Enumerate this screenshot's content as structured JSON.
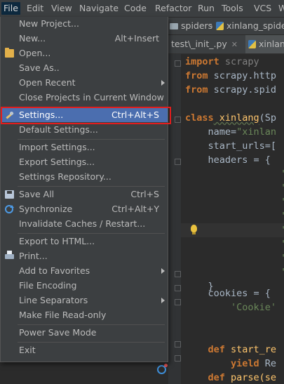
{
  "menubar": {
    "items": [
      "File",
      "Edit",
      "View",
      "Navigate",
      "Code",
      "Refactor",
      "Run",
      "Tools",
      "VCS",
      "W"
    ]
  },
  "breadcrumbs": {
    "folder": "spiders",
    "file": "xinlang_spide"
  },
  "tabs": {
    "first": "test\\_init_.py",
    "second": "xinlan"
  },
  "code": {
    "l1_kw": "import",
    "l1_rest": " scrapy",
    "l2_kw": "from",
    "l2_rest": " scrapy.http",
    "l3_kw": "from",
    "l3_rest": " scrapy.spid",
    "l5_kw": "class",
    "l5_cls": " xinlang",
    "l5_rest": "(Sp",
    "l6_a": "    name=",
    "l6_str": "\"xinlan",
    "l7": "    start_urls=[",
    "l8": "    headers = {",
    "l8_str": "'",
    "l17": "    }",
    "l18": "    cookies = {",
    "l19_str": "        'Cookie'",
    "l23_kw": "    def",
    "l23_rest": " start_re",
    "l24_kw": "        yield",
    "l24_rest": " Re",
    "l25_kw": "    def",
    "l25_rest": " parse(se"
  },
  "file_menu": {
    "new_project": "New Project...",
    "new": "New...",
    "new_sc": "Alt+Insert",
    "open": "Open...",
    "save_as": "Save As..",
    "open_recent": "Open Recent",
    "close_projects": "Close Projects in Current Window",
    "settings": "Settings...",
    "settings_sc": "Ctrl+Alt+S",
    "default_settings": "Default Settings...",
    "import_settings": "Import Settings...",
    "export_settings": "Export Settings...",
    "settings_repo": "Settings Repository...",
    "save_all": "Save All",
    "save_all_sc": "Ctrl+S",
    "synchronize": "Synchronize",
    "synchronize_sc": "Ctrl+Alt+Y",
    "invalidate": "Invalidate Caches / Restart...",
    "export_html": "Export to HTML...",
    "print": "Print...",
    "add_favorites": "Add to Favorites",
    "file_encoding": "File Encoding",
    "line_separators": "Line Separators",
    "make_readonly": "Make File Read-only",
    "power_save": "Power Save Mode",
    "exit": "Exit"
  },
  "colors": {
    "menu_bg": "#3c3f41",
    "highlight": "#4b6eaf",
    "annotation_box": "#e21d1d",
    "editor_bg": "#2b2b2b"
  }
}
